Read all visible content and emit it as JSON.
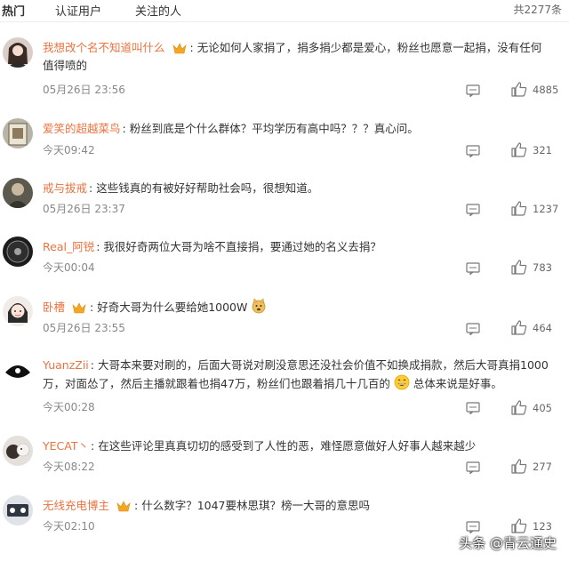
{
  "tabs": {
    "hot": "热门",
    "verified": "认证用户",
    "followed": "关注的人",
    "total": "共2277条"
  },
  "comments": [
    {
      "user": "我想改个名不知道叫什么",
      "text": "无论如何人家捐了，捐多捐少都是爱心，粉丝也愿意一起捐，没有任何",
      "text2": "值得喷的",
      "time": "05月26日 23:56",
      "likes": "4885"
    },
    {
      "user": "爱笑的超越菜鸟",
      "text": "粉丝到底是个什么群体？平均学历有高中吗？？？真心问。",
      "time": "今天09:42",
      "likes": "321"
    },
    {
      "user": "戒与拔戒",
      "text": "这些钱真的有被好好帮助社会吗，很想知道。",
      "time": "05月26日 23:37",
      "likes": "1237"
    },
    {
      "user": "Real_阿锐",
      "text": "我很好奇两位大哥为啥不直接捐，要通过她的名义去捐？",
      "time": "今天00:04",
      "likes": "783"
    },
    {
      "user": "卧槽",
      "text": "好奇大哥为什么要给她1000W",
      "time": "05月26日 23:55",
      "likes": "464"
    },
    {
      "user": "YuanzZii",
      "text": "大哥本来要对刷的，后面大哥说对刷没意思还没社会价值不如换成捐款，然后大哥真捐1000",
      "text2": "万，对面怂了，然后主播就跟着也捐47万，粉丝们也跟着捐几十几百的",
      "text2b": "总体来说是好事。",
      "time": "今天00:28",
      "likes": "405"
    },
    {
      "user": "YECAT丶",
      "text": "在这些评论里真真切切的感受到了人性的恶，难怪愿意做好人好事人越来越少",
      "time": "今天08:22",
      "likes": "277"
    },
    {
      "user": "无线充电博主",
      "text": "什么数字？1047要林思琪？榜一大哥的意思吗",
      "time": "今天02:10",
      "likes": "123"
    }
  ],
  "watermark": "头条 @青云通史",
  "colors": {
    "username": "#eb7340",
    "text": "#333333",
    "meta": "#888888",
    "crown": "#f5a623"
  },
  "icons": {
    "crown": "crown-icon",
    "reply": "comment-icon",
    "like": "thumbs-up-icon"
  }
}
